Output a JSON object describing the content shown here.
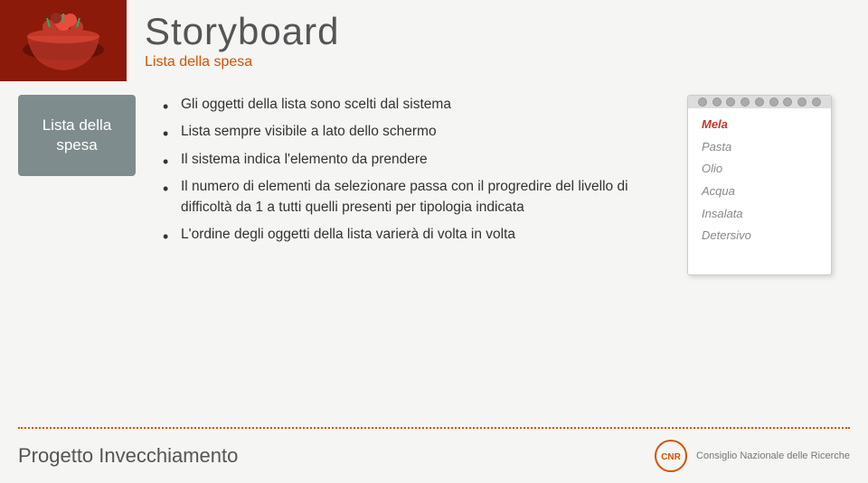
{
  "header": {
    "title": "Storyboard",
    "subtitle": "Lista della spesa"
  },
  "label": {
    "text": "Lista della\nspesa"
  },
  "bullets": [
    "Gli oggetti della lista sono scelti dal sistema",
    "Lista sempre visibile a lato dello schermo",
    "Il sistema indica l'elemento da prendere",
    "Il numero di elementi da selezionare passa con il progredire del livello di difficoltà da 1 a tutti quelli presenti per tipologia indicata",
    "L'ordine degli oggetti della lista varierà di volta in volta"
  ],
  "notebook": {
    "items": [
      "Mela",
      "Pasta",
      "Olio",
      "Acqua",
      "Insalata",
      "Detersivo"
    ],
    "highlighted_index": 0
  },
  "footer": {
    "project_title": "Progetto Invecchiamento",
    "logo_line1": "Consiglio Nazionale delle Ricerche",
    "logo_line2": ""
  }
}
